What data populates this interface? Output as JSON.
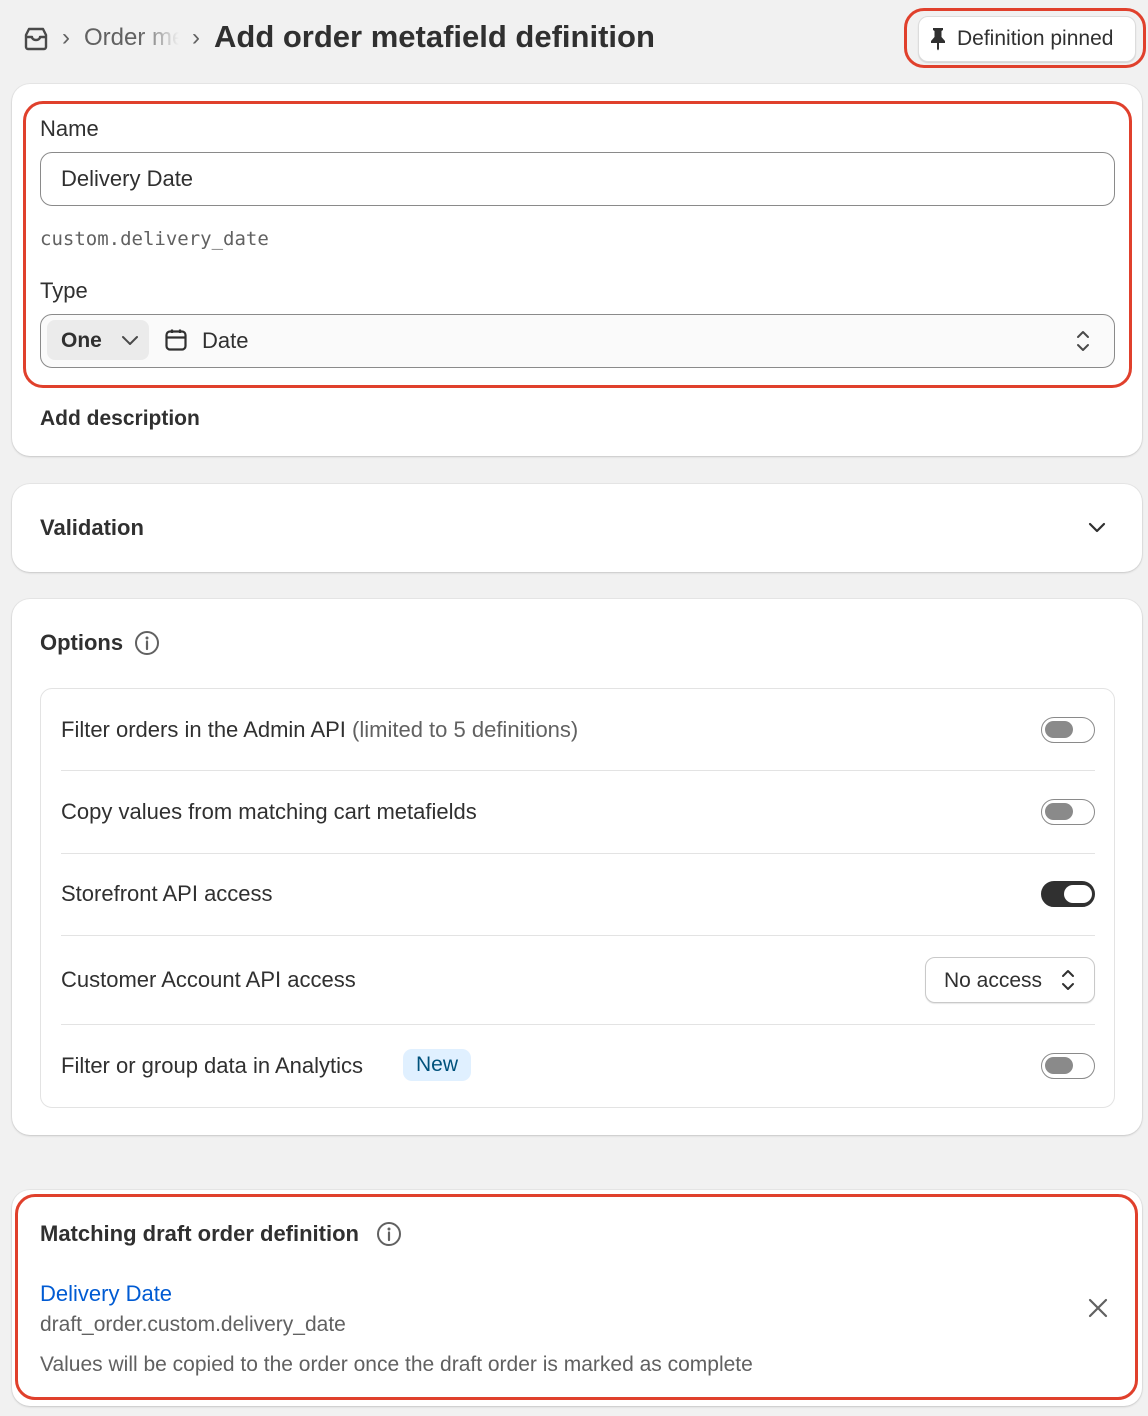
{
  "header": {
    "breadcrumb_link": "Order metafield definitions",
    "breadcrumb_sep": "›",
    "title": "Add order metafield definition",
    "pin_button_label": "Definition pinned"
  },
  "definition": {
    "name_label": "Name",
    "name_value": "Delivery Date",
    "namespace_key": "custom.delivery_date",
    "type_label": "Type",
    "list_selector": "One",
    "type_value": "Date",
    "add_description": "Add description"
  },
  "validation": {
    "title": "Validation"
  },
  "options": {
    "title": "Options",
    "rows": [
      {
        "label": "Filter orders in the Admin API",
        "note": "(limited to 5 definitions)",
        "toggle": false
      },
      {
        "label": "Copy values from matching cart metafields",
        "toggle": false
      },
      {
        "label": "Storefront API access",
        "toggle": true
      },
      {
        "label": "Customer Account API access",
        "select_value": "No access"
      },
      {
        "label": "Filter or group data in Analytics",
        "badge": "New",
        "toggle": false
      }
    ]
  },
  "matching": {
    "title": "Matching draft order definition",
    "link_name": "Delivery Date",
    "key": "draft_order.custom.delivery_date",
    "description": "Values will be copied to the order once the draft order is marked as complete"
  },
  "colors": {
    "accent_link": "#005bd3",
    "highlight": "#e0402c",
    "badge_bg": "#e0f0ff"
  }
}
